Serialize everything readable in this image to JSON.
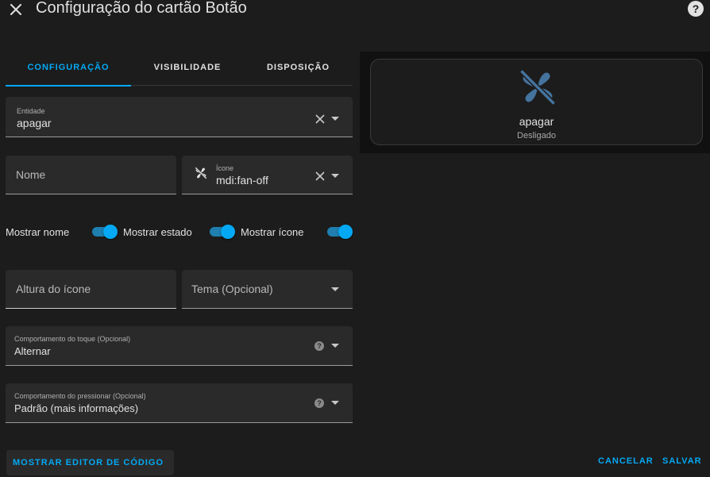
{
  "dialog": {
    "title": "Configuração do cartão Botão",
    "close_icon": "close-icon",
    "help_icon": "help-circle-icon",
    "help_glyph": "?"
  },
  "tabs": [
    {
      "label": "CONFIGURAÇÃO",
      "active": true
    },
    {
      "label": "VISIBILIDADE",
      "active": false
    },
    {
      "label": "DISPOSIÇÃO",
      "active": false
    }
  ],
  "form": {
    "entity": {
      "label": "Entidade",
      "value": "apagar"
    },
    "name": {
      "placeholder": "Nome"
    },
    "icon": {
      "label": "Ícone",
      "value": "mdi:fan-off",
      "icon": "fan-off-icon"
    },
    "toggles": [
      {
        "label": "Mostrar nome",
        "on": true
      },
      {
        "label": "Mostrar estado",
        "on": true
      },
      {
        "label": "Mostrar ícone",
        "on": true
      }
    ],
    "icon_height": {
      "placeholder": "Altura do ícone"
    },
    "theme": {
      "placeholder": "Tema (Opcional)"
    },
    "tap_action": {
      "label": "Comportamento do toque (Opcional)",
      "value": "Alternar"
    },
    "hold_action": {
      "label": "Comportamento do pressionar (Opcional)",
      "value": "Padrão (mais informações)"
    },
    "help_glyph": "?"
  },
  "preview": {
    "name": "apagar",
    "state": "Desligado",
    "icon": "fan-off-icon",
    "icon_color": "#44739e"
  },
  "footer": {
    "show_editor": "MOSTRAR EDITOR DE CÓDIGO",
    "cancel": "CANCELAR",
    "save": "SALVAR"
  },
  "colors": {
    "accent": "#03a9f4",
    "background": "#1c1c1c",
    "field": "#2a2a2a",
    "text": "#e1e1e1"
  }
}
